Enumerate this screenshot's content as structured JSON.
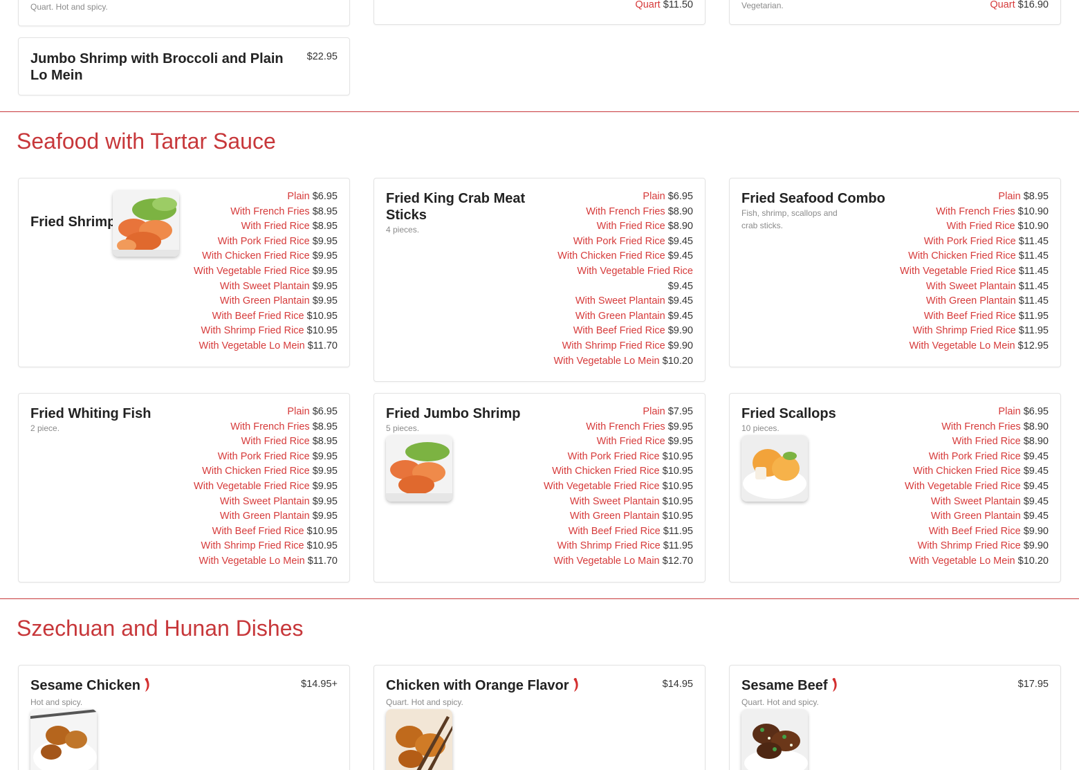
{
  "colors": {
    "accent": "#c7373a",
    "option": "#d63a3a"
  },
  "top_partial": {
    "card1_desc": "Quart. Hot and spicy.",
    "card2": {
      "label": "Quart",
      "price": "$11.50"
    },
    "card3": {
      "desc": "Vegetarian.",
      "label": "Quart",
      "price": "$16.90"
    },
    "jumbo": {
      "title": "Jumbo Shrimp with Broccoli and Plain Lo Mein",
      "price": "$22.95"
    }
  },
  "sections": {
    "seafood": {
      "title": "Seafood with Tartar Sauce",
      "items": [
        {
          "title": "Fried Shrimp",
          "image_icon": "fried-shrimp-photo",
          "prices": [
            [
              "Plain",
              "$6.95"
            ],
            [
              "With French Fries",
              "$8.95"
            ],
            [
              "With Fried Rice",
              "$8.95"
            ],
            [
              "With Pork Fried Rice",
              "$9.95"
            ],
            [
              "With Chicken Fried Rice",
              "$9.95"
            ],
            [
              "With Vegetable Fried Rice",
              "$9.95"
            ],
            [
              "With Sweet Plantain",
              "$9.95"
            ],
            [
              "With Green Plantain",
              "$9.95"
            ],
            [
              "With Beef Fried Rice",
              "$10.95"
            ],
            [
              "With Shrimp Fried Rice",
              "$10.95"
            ],
            [
              "With Vegetable Lo Mein",
              "$11.70"
            ]
          ]
        },
        {
          "title": "Fried King Crab Meat Sticks",
          "desc": "4 pieces.",
          "prices": [
            [
              "Plain",
              "$6.95"
            ],
            [
              "With French Fries",
              "$8.90"
            ],
            [
              "With Fried Rice",
              "$8.90"
            ],
            [
              "With Pork Fried Rice",
              "$9.45"
            ],
            [
              "With Chicken Fried Rice",
              "$9.45"
            ],
            [
              "With Vegetable Fried Rice",
              "$9.45"
            ],
            [
              "With Sweet Plantain",
              "$9.45"
            ],
            [
              "With Green Plantain",
              "$9.45"
            ],
            [
              "With Beef Fried Rice",
              "$9.90"
            ],
            [
              "With Shrimp Fried Rice",
              "$9.90"
            ],
            [
              "With Vegetable Lo Mein",
              "$10.20"
            ]
          ]
        },
        {
          "title": "Fried Seafood Combo",
          "desc": "Fish, shrimp, scallops and crab sticks.",
          "prices": [
            [
              "Plain",
              "$8.95"
            ],
            [
              "With French Fries",
              "$10.90"
            ],
            [
              "With Fried Rice",
              "$10.90"
            ],
            [
              "With Pork Fried Rice",
              "$11.45"
            ],
            [
              "With Chicken Fried Rice",
              "$11.45"
            ],
            [
              "With Vegetable Fried Rice",
              "$11.45"
            ],
            [
              "With Sweet Plantain",
              "$11.45"
            ],
            [
              "With Green Plantain",
              "$11.45"
            ],
            [
              "With Beef Fried Rice",
              "$11.95"
            ],
            [
              "With Shrimp Fried Rice",
              "$11.95"
            ],
            [
              "With Vegetable Lo Mein",
              "$12.95"
            ]
          ]
        },
        {
          "title": "Fried Whiting Fish",
          "desc": "2 piece.",
          "prices": [
            [
              "Plain",
              "$6.95"
            ],
            [
              "With French Fries",
              "$8.95"
            ],
            [
              "With Fried Rice",
              "$8.95"
            ],
            [
              "With Pork Fried Rice",
              "$9.95"
            ],
            [
              "With Chicken Fried Rice",
              "$9.95"
            ],
            [
              "With Vegetable Fried Rice",
              "$9.95"
            ],
            [
              "With Sweet Plantain",
              "$9.95"
            ],
            [
              "With Green Plantain",
              "$9.95"
            ],
            [
              "With Beef Fried Rice",
              "$10.95"
            ],
            [
              "With Shrimp Fried Rice",
              "$10.95"
            ],
            [
              "With Vegetable Lo Mein",
              "$11.70"
            ]
          ]
        },
        {
          "title": "Fried Jumbo Shrimp",
          "desc": "5 pieces.",
          "image_icon": "fried-jumbo-shrimp-photo",
          "prices": [
            [
              "Plain",
              "$7.95"
            ],
            [
              "With French Fries",
              "$9.95"
            ],
            [
              "With Fried Rice",
              "$9.95"
            ],
            [
              "With Pork Fried Rice",
              "$10.95"
            ],
            [
              "With Chicken Fried Rice",
              "$10.95"
            ],
            [
              "With Vegetable Fried Rice",
              "$10.95"
            ],
            [
              "With Sweet Plantain",
              "$10.95"
            ],
            [
              "With Green Plantain",
              "$10.95"
            ],
            [
              "With Beef Fried Rice",
              "$11.95"
            ],
            [
              "With Shrimp Fried Rice",
              "$11.95"
            ],
            [
              "With Vegetable Lo Main",
              "$12.70"
            ]
          ]
        },
        {
          "title": "Fried Scallops",
          "desc": "10 pieces.",
          "image_icon": "fried-scallops-photo",
          "prices": [
            [
              "Plain",
              "$6.95"
            ],
            [
              "With French Fries",
              "$8.90"
            ],
            [
              "With Fried Rice",
              "$8.90"
            ],
            [
              "With Pork Fried Rice",
              "$9.45"
            ],
            [
              "With Chicken Fried Rice",
              "$9.45"
            ],
            [
              "With Vegetable Fried Rice",
              "$9.45"
            ],
            [
              "With Sweet Plantain",
              "$9.45"
            ],
            [
              "With Green Plantain",
              "$9.45"
            ],
            [
              "With Beef Fried Rice",
              "$9.90"
            ],
            [
              "With Shrimp Fried Rice",
              "$9.90"
            ],
            [
              "With Vegetable Lo Mein",
              "$10.20"
            ]
          ]
        }
      ]
    },
    "szechuan": {
      "title": "Szechuan and Hunan Dishes",
      "items": [
        {
          "title": "Sesame Chicken",
          "desc": "Hot and spicy.",
          "price": "$14.95+",
          "image_icon": "sesame-chicken-photo",
          "spicy_icon": "chili-pepper-icon"
        },
        {
          "title": "Chicken with Orange Flavor",
          "desc": "Quart. Hot and spicy.",
          "price": "$14.95",
          "image_icon": "orange-chicken-photo",
          "spicy_icon": "chili-pepper-icon"
        },
        {
          "title": "Sesame Beef",
          "desc": "Quart. Hot and spicy.",
          "price": "$17.95",
          "image_icon": "sesame-beef-photo",
          "spicy_icon": "chili-pepper-icon"
        }
      ]
    }
  }
}
